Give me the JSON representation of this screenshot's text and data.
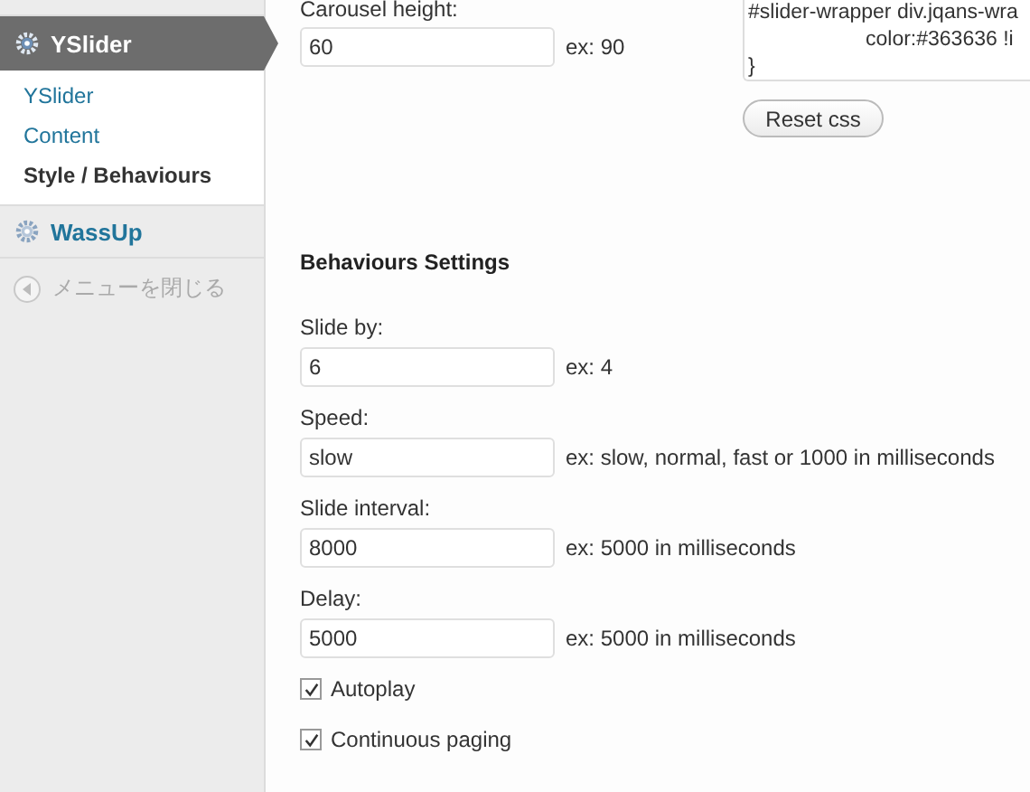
{
  "sidebar": {
    "menus": [
      {
        "label": "YSlider",
        "expanded": true,
        "children": [
          {
            "label": "YSlider",
            "selected": false
          },
          {
            "label": "Content",
            "selected": false
          },
          {
            "label": "Style / Behaviours",
            "selected": true
          }
        ]
      },
      {
        "label": "WassUp",
        "expanded": false
      }
    ],
    "collapse_label": "メニューを閉じる"
  },
  "style_settings": {
    "field": {
      "label": "Carousel height:",
      "value": "60",
      "hint": "ex: 90"
    },
    "css_lines": [
      "#slider-wrapper div.jqans-wra",
      "color:#363636 !i",
      "}"
    ],
    "reset_button": "Reset css"
  },
  "behaviours": {
    "heading": "Behaviours Settings",
    "fields": [
      {
        "label": "Slide by:",
        "value": "6",
        "hint": "ex: 4"
      },
      {
        "label": "Speed:",
        "value": "slow",
        "hint": "ex: slow, normal, fast or 1000 in milliseconds"
      },
      {
        "label": "Slide interval:",
        "value": "8000",
        "hint": "ex: 5000 in milliseconds"
      },
      {
        "label": "Delay:",
        "value": "5000",
        "hint": "ex: 5000 in milliseconds"
      }
    ],
    "checkboxes": [
      {
        "label": "Autoplay",
        "checked": true
      },
      {
        "label": "Continuous paging",
        "checked": true
      }
    ]
  }
}
